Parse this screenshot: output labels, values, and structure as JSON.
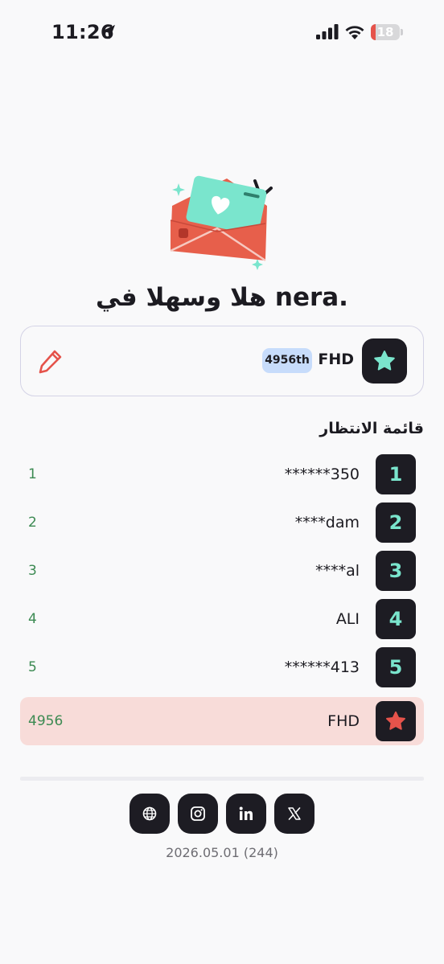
{
  "status_bar": {
    "time": "11:26",
    "battery_level": "18",
    "battery_fraction": 0.18,
    "battery_color": "#e5534b"
  },
  "welcome": {
    "title": "هلا وسهلا في nera."
  },
  "user_card": {
    "name": "FHD",
    "rank_badge": "4956th",
    "avatar_icon": "star-icon",
    "avatar_color": "#7ae5cd",
    "edit_icon": "pencil-icon"
  },
  "waitlist": {
    "title": "قائمة الانتظار",
    "rows": [
      {
        "rank": "1",
        "name": "******350",
        "position": "1"
      },
      {
        "rank": "2",
        "name": "****dam",
        "position": "2"
      },
      {
        "rank": "3",
        "name": "****al",
        "position": "3"
      },
      {
        "rank": "4",
        "name": "ALI",
        "position": "4"
      },
      {
        "rank": "5",
        "name": "******413",
        "position": "5"
      }
    ],
    "current_user": {
      "name": "FHD",
      "position": "4956",
      "icon": "star-icon",
      "icon_color": "#e5534b"
    }
  },
  "footer": {
    "social_icons": [
      "globe-icon",
      "instagram-icon",
      "linkedin-icon",
      "x-icon"
    ],
    "version": "2026.05.01 (244)"
  },
  "colors": {
    "accent_mint": "#7ae5cd",
    "accent_red": "#e5534b",
    "highlight_row": "#f8dcd9",
    "badge_blue": "#c7dcfb",
    "position_green": "#3c8a52",
    "dark_tile": "#1d1c23"
  }
}
